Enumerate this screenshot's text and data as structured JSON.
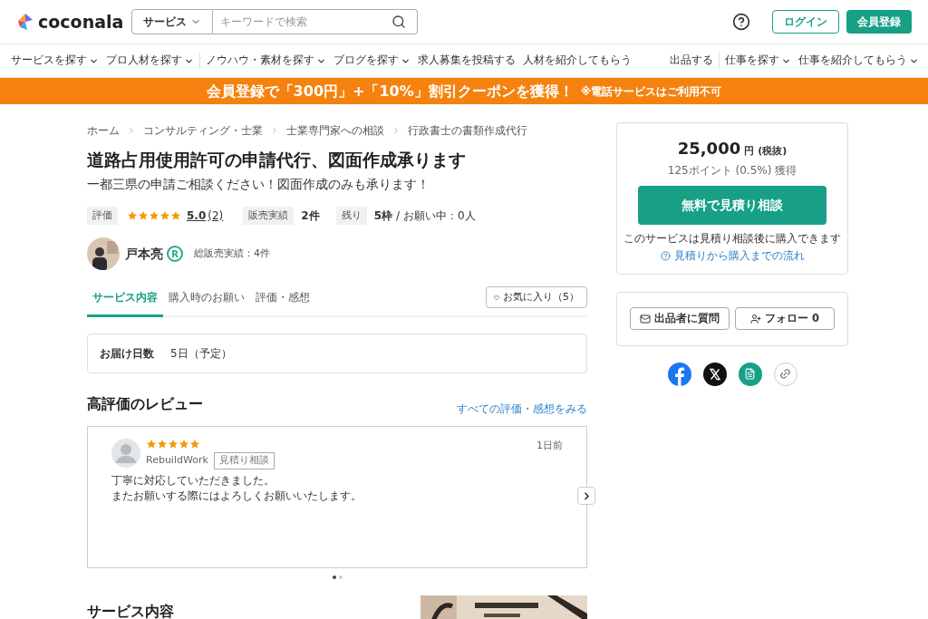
{
  "header": {
    "logo": "coconala",
    "search": {
      "category": "サービス",
      "placeholder": "キーワードで検索"
    },
    "login": "ログイン",
    "signup": "会員登録"
  },
  "nav": {
    "left_groups": [
      [
        {
          "label": "サービスを探す",
          "has_menu": true
        },
        {
          "label": "プロ人材を探す",
          "has_menu": true
        }
      ],
      [
        {
          "label": "ノウハウ・素材を探す",
          "has_menu": true
        },
        {
          "label": "ブログを探す",
          "has_menu": true
        },
        {
          "label": "求人募集を投稿する",
          "has_menu": false
        },
        {
          "label": "人材を紹介してもらう",
          "has_menu": false
        }
      ]
    ],
    "right_groups": [
      [
        {
          "label": "出品する",
          "has_menu": false
        }
      ],
      [
        {
          "label": "仕事を探す",
          "has_menu": true
        },
        {
          "label": "仕事を紹介してもらう",
          "has_menu": true
        }
      ]
    ]
  },
  "banner": {
    "text": "会員登録で「300円」+「10%」割引クーポンを獲得！",
    "note": "※電話サービスはご利用不可"
  },
  "breadcrumbs": [
    "ホーム",
    "コンサルティング・士業",
    "士業専門家への相談",
    "行政書士の書類作成代行"
  ],
  "title": "道路占用使用許可の申請代行、図面作成承ります",
  "subtitle": "一都三県の申請ご相談ください！図面作成のみも承ります！",
  "stats": {
    "rating_label": "評価",
    "stars": 5,
    "score": "5.0",
    "count": "(2)",
    "sales_label": "販売実績",
    "sales": "2件",
    "remaining_label": "残り",
    "remaining": "5枠",
    "separator": "/",
    "waiting": "お願い中：0人"
  },
  "seller": {
    "name": "戸本亮",
    "badge": "R",
    "total_sales": "総販売実績：4件"
  },
  "tabs": [
    {
      "label": "サービス内容",
      "selected": true
    },
    {
      "label": "購入時のお願い",
      "selected": false
    },
    {
      "label": "評価・感想",
      "selected": false
    }
  ],
  "favorite": "お気に入り（5）",
  "delivery": {
    "label": "お届け日数",
    "value": "5日（予定）"
  },
  "reviews": {
    "heading": "高評価のレビュー",
    "see_all": "すべての評価・感想をみる",
    "items": [
      {
        "stars": 5,
        "user": "RebuildWork",
        "tag": "見積り相談",
        "time": "1日前",
        "text": [
          "丁寧に対応していただきました。",
          "またお願いする際にはよろしくお願いいたします。"
        ]
      }
    ],
    "dots": [
      {
        "selected": true
      },
      {
        "selected": false
      }
    ]
  },
  "service_heading": "サービス内容",
  "price": {
    "amount": "25,000",
    "unit": "円",
    "tax": "(税抜)",
    "points": "125ポイント (0.5%) 獲得",
    "cta": "無料で見積り相談",
    "note": "このサービスは見積り相談後に購入できます",
    "flow_link": "見積りから購入までの流れ"
  },
  "actions": {
    "question": "出品者に質問",
    "follow": "フォロー 0"
  }
}
